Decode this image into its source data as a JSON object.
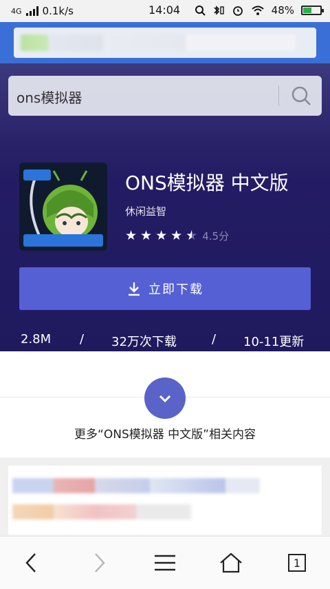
{
  "status_bar": {
    "network": "4G",
    "speed": "0.1k/s",
    "time": "14:04",
    "battery": "48%",
    "battery_level": 0.48
  },
  "search": {
    "query": "ons模拟器"
  },
  "app": {
    "title": "ONS模拟器 中文版",
    "category": "休闲益智",
    "rating_stars": 4.5,
    "rating_text": "4.5分",
    "download_label": "立即下载",
    "size": "2.8M",
    "downloads": "32万次下载",
    "updated": "10-11更新",
    "separator": "/"
  },
  "more": {
    "label": "更多“ONS模拟器 中文版”相关内容"
  },
  "bottom_nav": {
    "tab_count": "1"
  },
  "colors": {
    "hero_bg": "#221c63",
    "accent_button": "#5460d4",
    "topbar": "#3a6fd8",
    "expand_circle": "#5a63c8"
  }
}
